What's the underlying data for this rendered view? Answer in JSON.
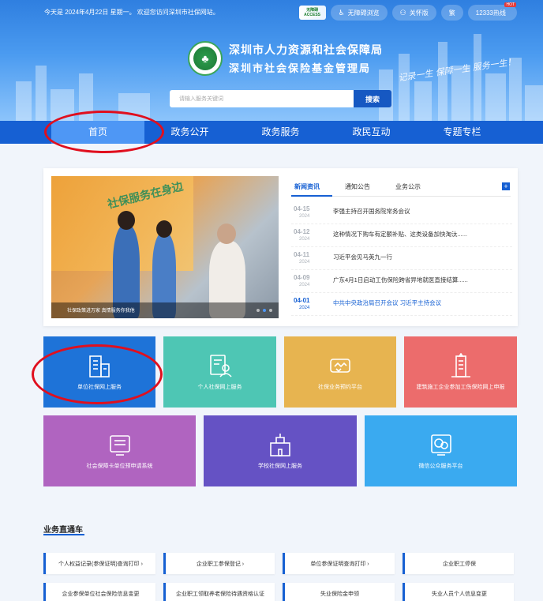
{
  "topbar": {
    "date_text": "今天是 2024年4月22日 星期一。 欢迎您访问深圳市社保网站。",
    "access_badge": "无障碍 ACCESS",
    "barrier_free_label": "无障碍浏览",
    "elder_label": "关怀版",
    "traditional_label": "繁",
    "hotline_label": "12333热线",
    "hotline_tag": "HOT"
  },
  "header": {
    "org_name_1": "深圳市人力资源和社会保障局",
    "org_name_2": "深圳市社会保险基金管理局",
    "slogan": "记录一生 保障一生 服务一生！",
    "emblem_glyph": "♣"
  },
  "search": {
    "placeholder": "请输入服务关键词",
    "button_label": "搜索"
  },
  "nav": {
    "items": [
      "首页",
      "政务公开",
      "政务服务",
      "政民互动",
      "专题专栏"
    ]
  },
  "news": {
    "photo_caption": "社保政策进万家 真情服务你我他",
    "banner_text": "社保服务在身边",
    "tabs": [
      "新闻资讯",
      "通知公告",
      "业务公示"
    ],
    "more_label": "+",
    "items": [
      {
        "day": "04-15",
        "year": "2024",
        "title": "李强主持召开国务院常务会议"
      },
      {
        "day": "04-12",
        "year": "2024",
        "title": "这种情况下购车有定额补贴、这类设备加快淘汰......"
      },
      {
        "day": "04-11",
        "year": "2024",
        "title": "习近平会见马英九一行"
      },
      {
        "day": "04-09",
        "year": "2024",
        "title": "广东4月1日启动工伤保险跨省异地就医直接结算......"
      },
      {
        "day": "04-01",
        "year": "2024",
        "title": "中共中央政治局召开会议 习近平主持会议"
      }
    ]
  },
  "services": {
    "row1": [
      {
        "label": "单位社保网上服务",
        "icon": "office-building-icon",
        "color": "#1e73d8"
      },
      {
        "label": "个人社保网上服务",
        "icon": "person-card-icon",
        "color": "#4ec6b4"
      },
      {
        "label": "社保业务预约平台",
        "icon": "handshake-icon",
        "color": "#e7b450"
      },
      {
        "label": "建筑施工企业参加工伤保险网上申报",
        "icon": "construction-building-icon",
        "color": "#ec6c6c"
      }
    ],
    "row2": [
      {
        "label": "社会保障卡单位预申请系统",
        "icon": "card-list-icon",
        "color": "#b064c0"
      },
      {
        "label": "学校社保网上服务",
        "icon": "school-icon",
        "color": "#6552c4"
      },
      {
        "label": "微信公众服务平台",
        "icon": "wechat-icon",
        "color": "#3aaaf0"
      }
    ]
  },
  "business": {
    "title": "业务直通车",
    "row1": [
      "个人权益记录(参保证明)查询打印 ›",
      "企业职工参保登记 ›",
      "单位参保证明查询打印 ›",
      "企业职工停保"
    ],
    "row2": [
      "企业参保单位社会保险信息变更",
      "企业职工领取养老保险待遇资格认证",
      "失业保险金申领",
      "失业人员个人信息变更"
    ]
  }
}
